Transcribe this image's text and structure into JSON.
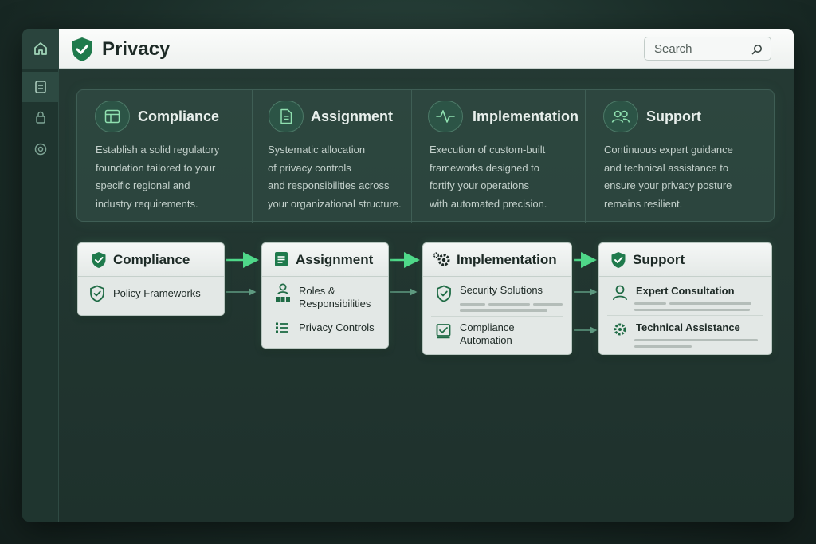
{
  "app": {
    "title": "Privacy"
  },
  "search": {
    "placeholder": "Search"
  },
  "sidebar": {
    "items": [
      {
        "name": "home-icon"
      },
      {
        "name": "document-icon"
      },
      {
        "name": "lock-icon"
      },
      {
        "name": "settings-icon"
      }
    ]
  },
  "overview": [
    {
      "title": "Compliance",
      "icon": "table-icon",
      "desc": [
        "Establish a solid regulatory",
        "foundation tailored to your",
        "specific regional and",
        "industry requirements."
      ]
    },
    {
      "title": "Assignment",
      "icon": "document-icon",
      "desc": [
        "Systematic allocation",
        "of privacy controls",
        "and responsibilities across",
        "your organizational structure."
      ]
    },
    {
      "title": "Implementation",
      "icon": "activity-icon",
      "desc": [
        "Execution of custom-built",
        "frameworks designed to",
        "fortify your operations",
        "with automated precision."
      ]
    },
    {
      "title": "Support",
      "icon": "users-icon",
      "desc": [
        "Continuous expert guidance",
        "and technical assistance to",
        "ensure your privacy posture",
        "remains resilient."
      ]
    }
  ],
  "flow": {
    "compliance": {
      "title": "Compliance",
      "items": [
        "Policy Frameworks"
      ]
    },
    "assignment": {
      "title": "Assignment",
      "items": [
        "Roles & Responsibilities",
        "Privacy Controls"
      ]
    },
    "implementation": {
      "title": "Implementation",
      "items": [
        "Security Solutions",
        "Compliance Automation"
      ]
    },
    "support": {
      "title": "Support",
      "items": [
        "Expert Consultation",
        "Technical Assistance"
      ]
    }
  },
  "colors": {
    "accent": "#3dba6e",
    "brand_shield": "#1f7a4c",
    "panel": "#345249"
  }
}
